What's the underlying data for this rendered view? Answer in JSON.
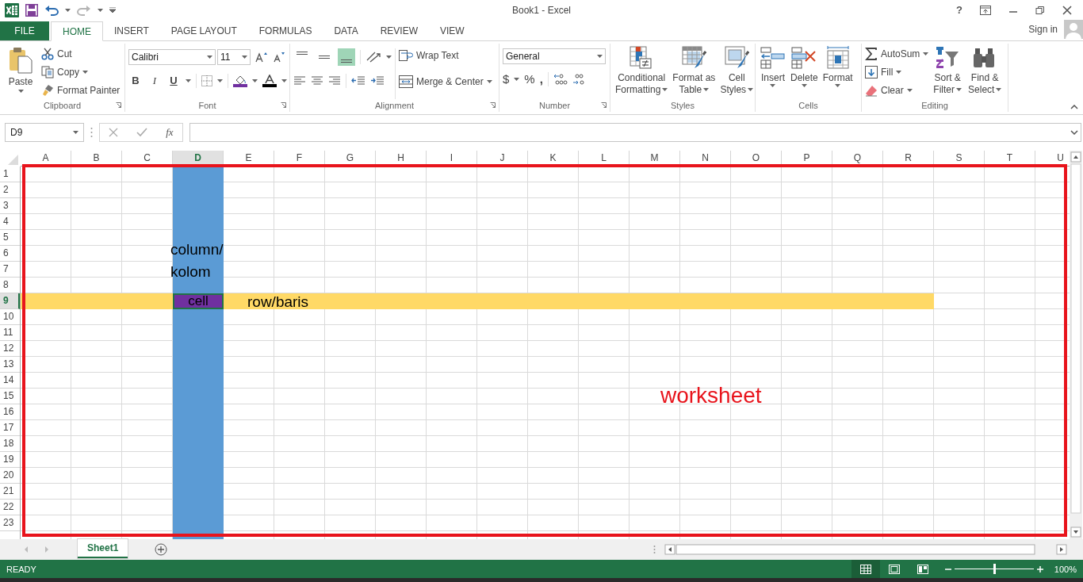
{
  "title_bar": {
    "title": "Book1 - Excel",
    "help": "?"
  },
  "tabs": [
    {
      "label": "FILE",
      "kind": "file",
      "selected": false
    },
    {
      "label": "HOME",
      "kind": "tab",
      "selected": true
    },
    {
      "label": "INSERT",
      "kind": "tab",
      "selected": false
    },
    {
      "label": "PAGE LAYOUT",
      "kind": "tab",
      "selected": false
    },
    {
      "label": "FORMULAS",
      "kind": "tab",
      "selected": false
    },
    {
      "label": "DATA",
      "kind": "tab",
      "selected": false
    },
    {
      "label": "REVIEW",
      "kind": "tab",
      "selected": false
    },
    {
      "label": "VIEW",
      "kind": "tab",
      "selected": false
    }
  ],
  "account": {
    "sign_in": "Sign in"
  },
  "ribbon": {
    "clipboard": {
      "label": "Clipboard",
      "paste": "Paste",
      "cut": "Cut",
      "copy": "Copy",
      "format_painter": "Format Painter"
    },
    "font": {
      "label": "Font",
      "font_name": "Calibri",
      "font_size": "11",
      "bold": "B",
      "italic": "I",
      "underline": "U"
    },
    "alignment": {
      "label": "Alignment",
      "vertical_align": [
        {
          "selected": false
        },
        {
          "selected": false
        },
        {
          "selected": true
        }
      ],
      "wrap_text": "Wrap Text",
      "merge": "Merge & Center"
    },
    "number": {
      "label": "Number",
      "format": "General",
      "currency": "$",
      "percent": "%",
      "comma": ","
    },
    "styles": {
      "label": "Styles",
      "buttons": [
        {
          "kind": "conditional",
          "lines": [
            "Conditional",
            "Formatting"
          ]
        },
        {
          "kind": "table",
          "lines": [
            "Format as",
            "Table"
          ]
        },
        {
          "kind": "cellstyles",
          "lines": [
            "Cell",
            "Styles"
          ]
        }
      ]
    },
    "cells": {
      "label": "Cells",
      "buttons": [
        {
          "kind": "insert",
          "lines": [
            "Insert"
          ]
        },
        {
          "kind": "delete",
          "lines": [
            "Delete"
          ]
        },
        {
          "kind": "format",
          "lines": [
            "Format"
          ]
        }
      ]
    },
    "editing": {
      "label": "Editing",
      "autosum": "AutoSum",
      "fill": "Fill",
      "clear": "Clear",
      "buttons": [
        {
          "kind": "sort",
          "lines": [
            "Sort &",
            "Filter"
          ]
        },
        {
          "kind": "find",
          "lines": [
            "Find &",
            "Select"
          ]
        }
      ]
    }
  },
  "formula_bar": {
    "name_box": "D9",
    "function_button": "fx"
  },
  "sheet": {
    "columns": [
      {
        "label": "A",
        "selected": false
      },
      {
        "label": "B",
        "selected": false
      },
      {
        "label": "C",
        "selected": false
      },
      {
        "label": "D",
        "selected": true
      },
      {
        "label": "E",
        "selected": false
      },
      {
        "label": "F",
        "selected": false
      },
      {
        "label": "G",
        "selected": false
      },
      {
        "label": "H",
        "selected": false
      },
      {
        "label": "I",
        "selected": false
      },
      {
        "label": "J",
        "selected": false
      },
      {
        "label": "K",
        "selected": false
      },
      {
        "label": "L",
        "selected": false
      },
      {
        "label": "M",
        "selected": false
      },
      {
        "label": "N",
        "selected": false
      },
      {
        "label": "O",
        "selected": false
      },
      {
        "label": "P",
        "selected": false
      },
      {
        "label": "Q",
        "selected": false
      },
      {
        "label": "R",
        "selected": false
      },
      {
        "label": "S",
        "selected": false
      },
      {
        "label": "T",
        "selected": false
      },
      {
        "label": "U",
        "selected": false
      }
    ],
    "rows": [
      {
        "label": "1",
        "selected": false
      },
      {
        "label": "2",
        "selected": false
      },
      {
        "label": "3",
        "selected": false
      },
      {
        "label": "4",
        "selected": false
      },
      {
        "label": "5",
        "selected": false
      },
      {
        "label": "6",
        "selected": false
      },
      {
        "label": "7",
        "selected": false
      },
      {
        "label": "8",
        "selected": false
      },
      {
        "label": "9",
        "selected": true
      },
      {
        "label": "10",
        "selected": false
      },
      {
        "label": "11",
        "selected": false
      },
      {
        "label": "12",
        "selected": false
      },
      {
        "label": "13",
        "selected": false
      },
      {
        "label": "14",
        "selected": false
      },
      {
        "label": "15",
        "selected": false
      },
      {
        "label": "16",
        "selected": false
      },
      {
        "label": "17",
        "selected": false
      },
      {
        "label": "18",
        "selected": false
      },
      {
        "label": "19",
        "selected": false
      },
      {
        "label": "20",
        "selected": false
      },
      {
        "label": "21",
        "selected": false
      },
      {
        "label": "22",
        "selected": false
      },
      {
        "label": "23",
        "selected": false
      }
    ],
    "highlights": [
      {
        "kind": "row",
        "color": "#ffd966"
      },
      {
        "kind": "column",
        "color": "#5b9bd5"
      }
    ],
    "annotations": [
      {
        "kind": "column",
        "text": "column/\nkolom"
      },
      {
        "kind": "cell",
        "text": "cell"
      },
      {
        "kind": "row",
        "text": "row/baris"
      },
      {
        "kind": "worksheet",
        "text": "worksheet"
      }
    ]
  },
  "sheet_tabs": [
    {
      "label": "Sheet1",
      "selected": true
    }
  ],
  "status_bar": {
    "status": "READY",
    "views": [
      {
        "kind": "normal",
        "selected": true
      },
      {
        "kind": "layout",
        "selected": false
      },
      {
        "kind": "pagebreak",
        "selected": false
      }
    ],
    "zoom": {
      "level": 0.5,
      "reading": "100%"
    }
  }
}
